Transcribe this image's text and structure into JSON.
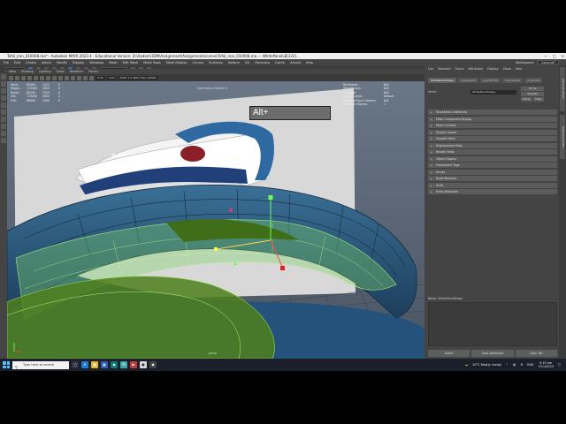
{
  "window": {
    "title": "Tefal_iron_010008.ma* - Autodesk MAYA 2022.4 - Educational Version: D:\\Aadam\\3DM\\Assignment\\Assignment\\scenes\\Tefal_iron_010008.ma  ---  WhitePanelL8[333]..."
  },
  "menubar": {
    "items": [
      "File",
      "Edit",
      "Create",
      "Select",
      "Modify",
      "Display",
      "Windows",
      "Mesh",
      "Edit Mesh",
      "Mesh Tools",
      "Mesh Display",
      "Curves",
      "Surfaces",
      "Deform",
      "UV",
      "Generate",
      "Cache",
      "Arnold",
      "Help"
    ],
    "workspace_label": "Workspace:",
    "workspace_value": "General*"
  },
  "statusline": {
    "live_field": "No Live Surface",
    "menu_set": "Modeling"
  },
  "viewport": {
    "menu": [
      "View",
      "Shading",
      "Lighting",
      "Show",
      "Renderer",
      "Panels"
    ],
    "toolbar_field_1": "0.00",
    "toolbar_field_2": "1.00",
    "color_space": "ACES 1.0 SDR-video (sRGB)",
    "camera_label": "Symmetry: Object X",
    "persp_label": "persp",
    "hud_left": [
      {
        "label": "Verts:",
        "c1": "85400",
        "c2": "1313",
        "c3": "0"
      },
      {
        "label": "Edges:",
        "c1": "170400",
        "c2": "2623",
        "c3": "0"
      },
      {
        "label": "Faces:",
        "c1": "85200",
        "c2": "1310",
        "c3": "0"
      },
      {
        "label": "Tris:",
        "c1": "170400",
        "c2": "2620",
        "c3": "0"
      },
      {
        "label": "UVs:",
        "c1": "88500",
        "c2": "1400",
        "c3": "0"
      }
    ],
    "hud_right": [
      {
        "label": "Backfaces:",
        "value": "N/A"
      },
      {
        "label": "Smoothness:",
        "value": "N/A"
      },
      {
        "label": "Instance:",
        "value": "N/A"
      },
      {
        "label": "Display Layer:",
        "value": "default"
      },
      {
        "label": "Distance From Camera:",
        "value": "N/A"
      },
      {
        "label": "Selected Objects:",
        "value": "1"
      }
    ],
    "overlay_key": "Alt+",
    "reference_logo": "Tefal"
  },
  "attribute_editor": {
    "menu": [
      "List",
      "Selected",
      "Focus",
      "Attributes",
      "Display",
      "Show",
      "Help"
    ],
    "tabs": [
      "WhitePanelShape",
      "polySplit40",
      "polySplit39",
      "polyTweak5",
      "polyCube"
    ],
    "mesh_label": "mesh:",
    "mesh_value": "WhitePanelShape",
    "focus_label": "Focus",
    "presets_label": "Presets",
    "show_label": "Show",
    "hide_label": "Hide",
    "sections": [
      "Tessellation Attributes",
      "Mesh Component Display",
      "Mesh Controls",
      "Tangent Space",
      "Smooth Mesh",
      "Displacement Map",
      "Render Stats",
      "Object Display",
      "Component Tags",
      "Arnold",
      "Node Behavior",
      "UUID",
      "Extra Attributes"
    ],
    "notes_label": "Notes:  WhitePanelShape",
    "bottom_buttons": [
      "Select",
      "Load Attributes",
      "Copy Tab"
    ],
    "side_tabs": [
      "Attribute Editor",
      "Modeling Toolkit"
    ]
  },
  "taskbar": {
    "search_placeholder": "Type here to search",
    "weather": "20°C  Mostly cloudy",
    "lang": "ENG",
    "time": "9:15 am",
    "date": "7/11/2023"
  },
  "colors": {
    "viewport_bg": "#5d6b7a",
    "panel": "#444444",
    "accent": "#4cc2ff",
    "selection_green": "#6fbf3a"
  }
}
